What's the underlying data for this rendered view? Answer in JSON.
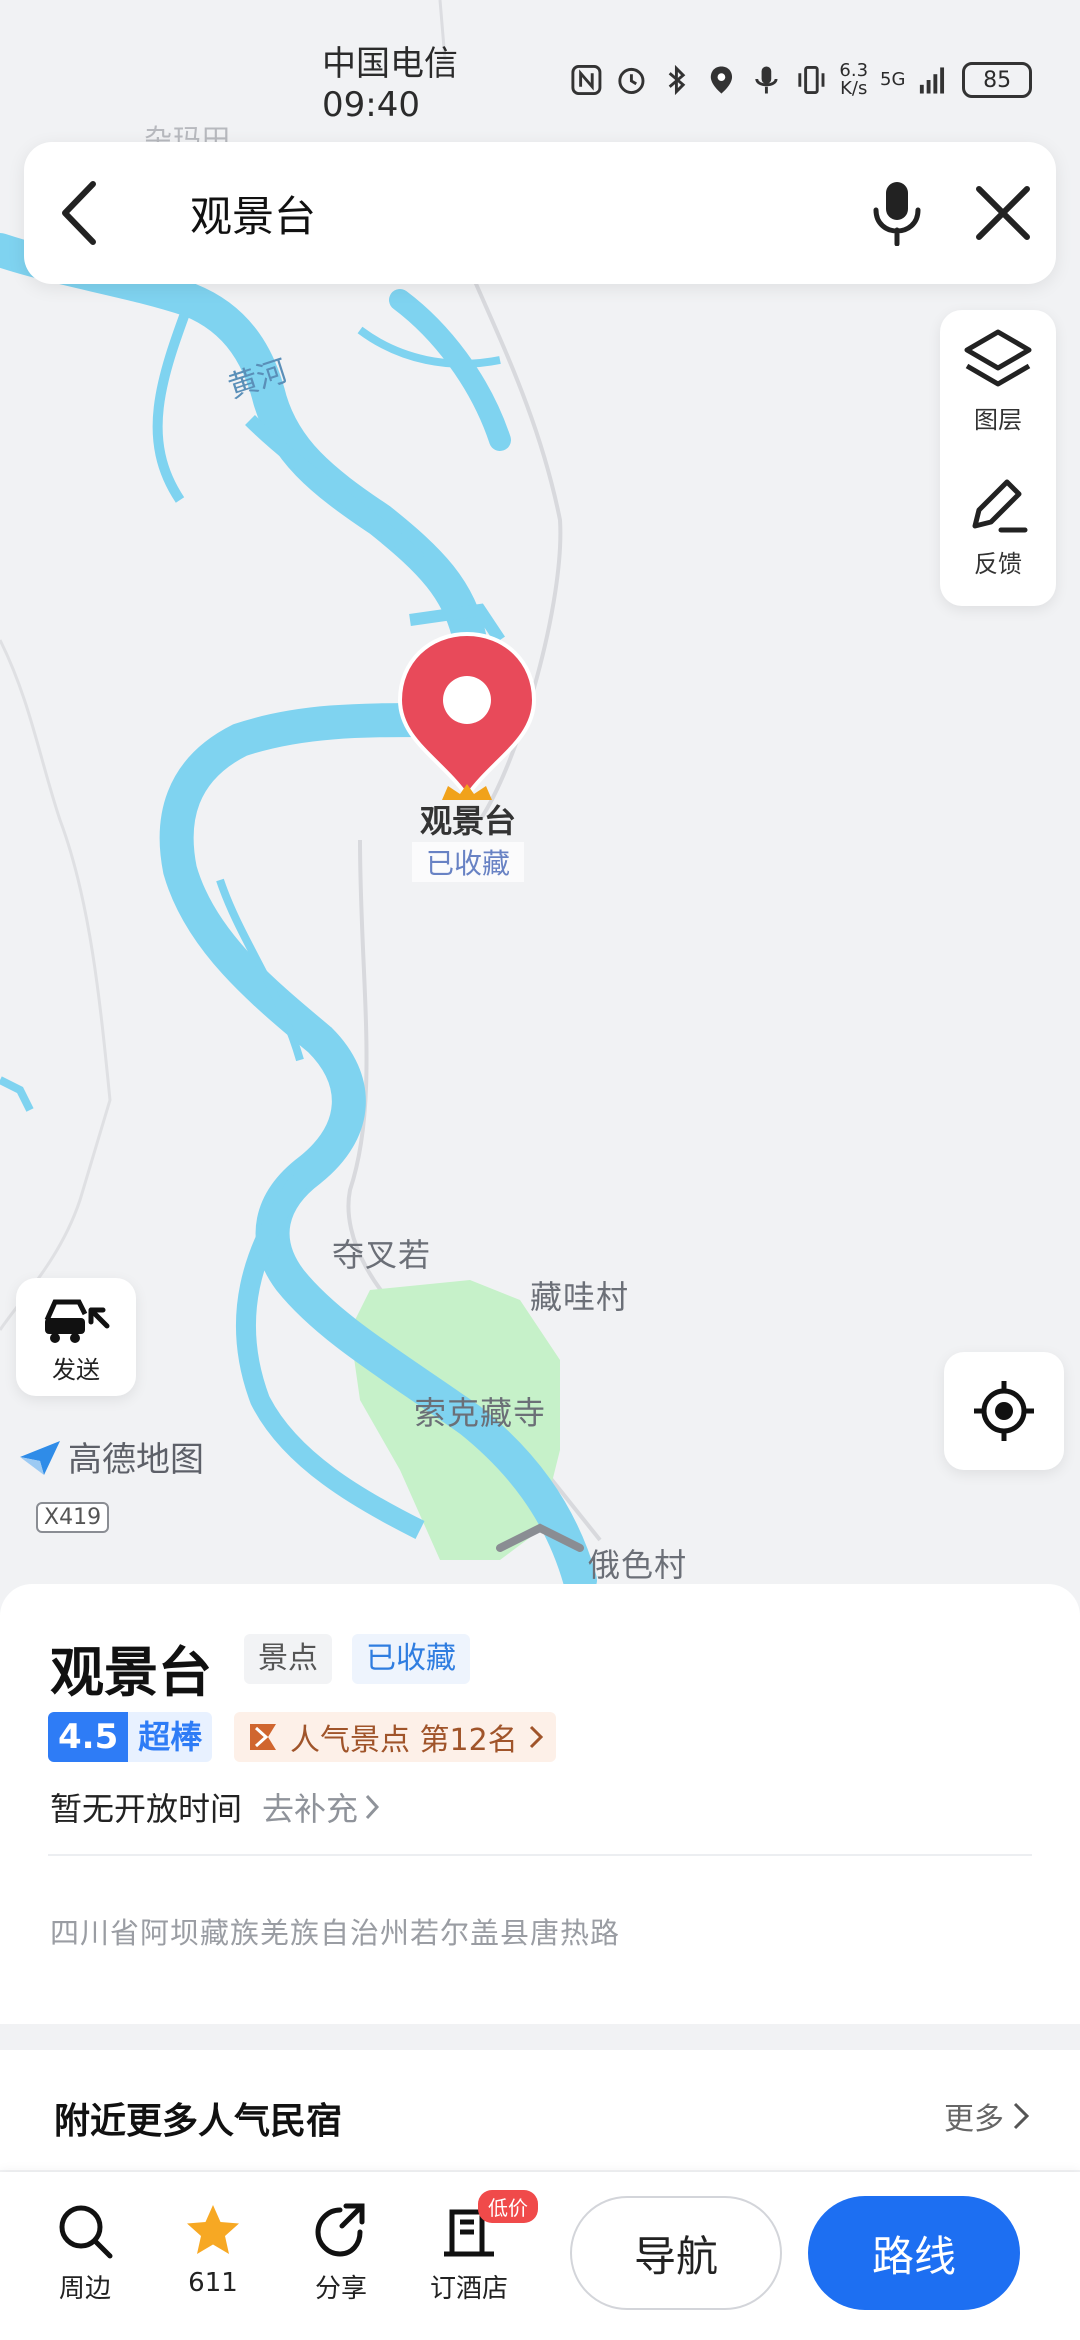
{
  "status_bar": {
    "carrier_time": "中国电信 09:40",
    "net_speed_value": "6.3",
    "net_speed_unit": "K/s",
    "network": "5G",
    "battery": "85"
  },
  "search": {
    "query": "观景台"
  },
  "tools": {
    "layers_label": "图层",
    "feedback_label": "反馈"
  },
  "map": {
    "top_label": "杂玛田",
    "river_label": "黄河",
    "places": [
      "夺叉若",
      "藏哇村",
      "索克藏寺",
      "俄色村"
    ],
    "road_shield": "X419",
    "brand": "高德地图",
    "send_label": "发送",
    "pin_title": "观景台",
    "pin_subtitle": "已收藏",
    "colors": {
      "river": "#7fd3f0",
      "green": "#c6f1c9",
      "pin": "#e84a5a"
    }
  },
  "poi": {
    "name": "观景台",
    "category": "景点",
    "favorite_tag": "已收藏",
    "score": "4.5",
    "score_text": "超棒",
    "rank_text": "人气景点 第12名",
    "hours": "暂无开放时间",
    "hours_action": "去补充",
    "address": "四川省阿坝藏族羌族自治州若尔盖县唐热路"
  },
  "nearby": {
    "heading": "附近更多人气民宿",
    "more": "更多"
  },
  "actions": {
    "around": "周边",
    "favorites_count": "611",
    "share": "分享",
    "hotel": "订酒店",
    "hotel_badge": "低价",
    "navigate": "导航",
    "route": "路线"
  }
}
